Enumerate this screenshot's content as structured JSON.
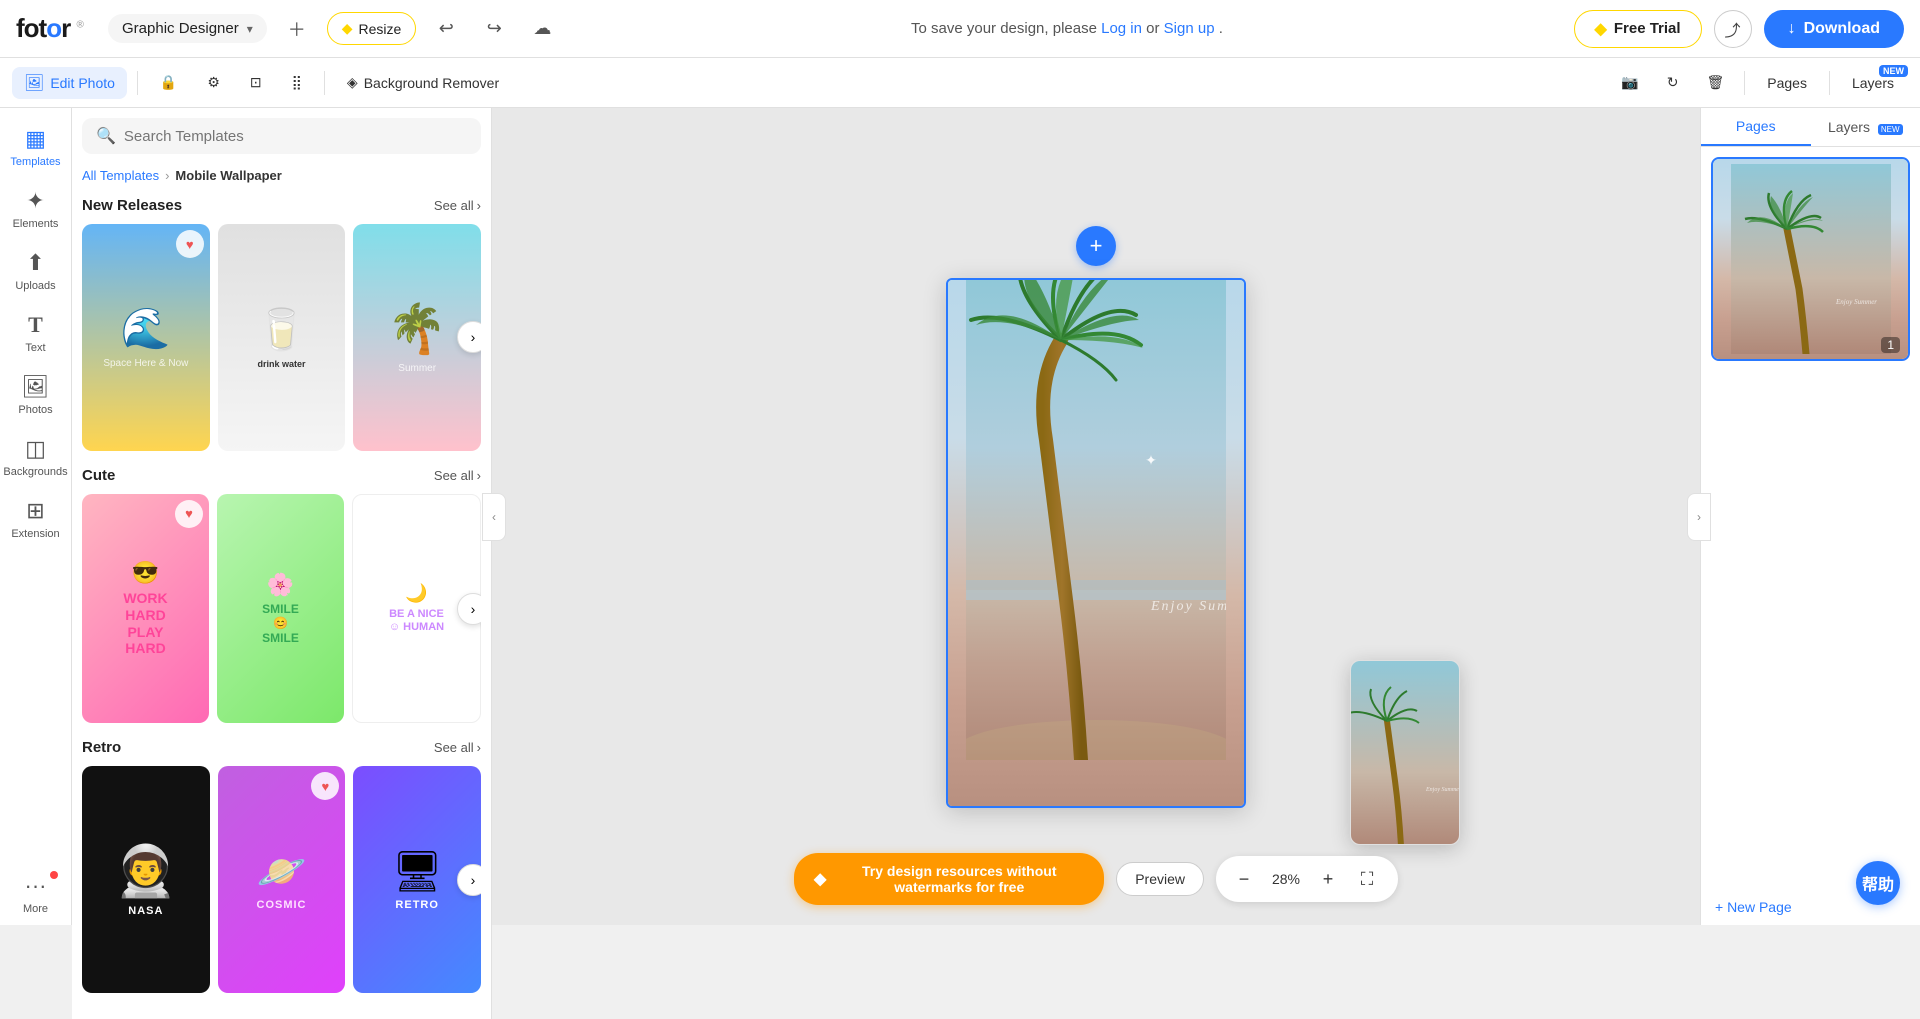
{
  "navbar": {
    "logo": "fotor",
    "app_selector": "Graphic Designer",
    "nav_message": "To save your design, please",
    "log_in_text": "Log in",
    "or_text": "or",
    "sign_up_text": "Sign up",
    "period": ".",
    "free_trial_label": "Free Trial",
    "download_label": "Download",
    "resize_label": "Resize"
  },
  "toolbar2": {
    "edit_photo_label": "Edit Photo",
    "lock_icon": "🔒",
    "adjust_icon": "⚙",
    "crop_icon": "⊡",
    "grid_icon": "⣿",
    "bg_remover_label": "Background Remover",
    "screenshot_icon": "📷",
    "refresh_icon": "↻",
    "delete_icon": "🗑",
    "pages_label": "Pages",
    "layers_label": "Layers",
    "new_badge": "NEW"
  },
  "sidebar": {
    "items": [
      {
        "label": "Templates",
        "icon": "▦"
      },
      {
        "label": "Elements",
        "icon": "✦"
      },
      {
        "label": "Uploads",
        "icon": "↑"
      },
      {
        "label": "Text",
        "icon": "T"
      },
      {
        "label": "Photos",
        "icon": "🖼"
      },
      {
        "label": "Backgrounds",
        "icon": "◫"
      },
      {
        "label": "Extension",
        "icon": "⊞"
      },
      {
        "label": "More",
        "icon": "•••"
      }
    ]
  },
  "templates_panel": {
    "search_placeholder": "Search Templates",
    "breadcrumb_all": "All Templates",
    "breadcrumb_current": "Mobile Wallpaper",
    "sections": [
      {
        "title": "New Releases",
        "see_all": "See all",
        "cards": [
          {
            "type": "new_releases_1",
            "has_heart": true
          },
          {
            "type": "new_releases_2",
            "has_heart": false
          },
          {
            "type": "new_releases_3",
            "has_heart": false
          }
        ]
      },
      {
        "title": "Cute",
        "see_all": "See all",
        "cards": [
          {
            "type": "cute_1",
            "has_heart": true
          },
          {
            "type": "cute_2",
            "has_heart": false
          },
          {
            "type": "cute_3",
            "has_heart": false
          }
        ]
      },
      {
        "title": "Retro",
        "see_all": "See all",
        "cards": [
          {
            "type": "retro_1",
            "has_heart": false
          },
          {
            "type": "retro_2",
            "has_heart": true
          },
          {
            "type": "retro_3",
            "has_heart": false
          }
        ]
      }
    ]
  },
  "canvas": {
    "summer_text": "Enjoy Summer",
    "page_count": 1,
    "add_page_icon": "+"
  },
  "zoom": {
    "level": "28%",
    "preview_label": "Preview",
    "minus_label": "−",
    "plus_label": "+"
  },
  "watermark": {
    "label": "Try design resources without watermarks for free"
  },
  "right_panel": {
    "pages_tab": "Pages",
    "layers_tab": "Layers",
    "new_page_label": "+ New Page",
    "page_number": "1"
  },
  "help": {
    "label": "帮助"
  }
}
